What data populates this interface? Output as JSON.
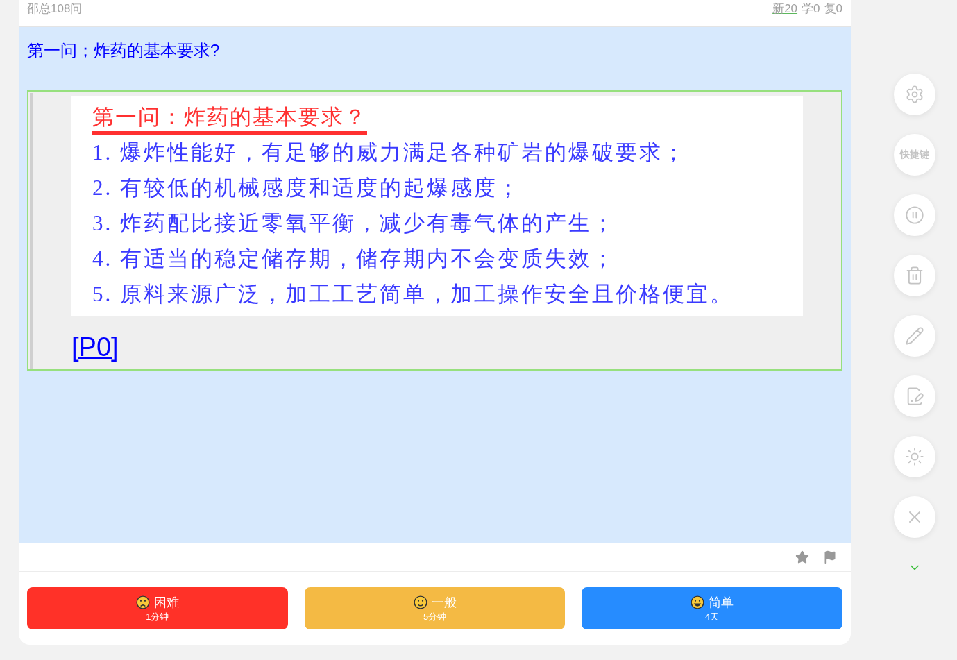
{
  "header": {
    "deck": "邵总108问",
    "counts": [
      {
        "label": "新20",
        "kind": "link"
      },
      {
        "label": "学0",
        "kind": "plain"
      },
      {
        "label": "复0",
        "kind": "plain"
      }
    ]
  },
  "question": "第一问；炸药的基本要求?",
  "answer": {
    "document": {
      "title": "第一问：炸药的基本要求？",
      "lines": [
        "1. 爆炸性能好，有足够的威力满足各种矿岩的爆破要求；",
        "2. 有较低的机械感度和适度的起爆感度；",
        "3. 炸药配比接近零氧平衡，减少有毒气体的产生；",
        "4. 有适当的稳定储存期，储存期内不会变质失效；",
        "5. 原料来源广泛，加工工艺简单，加工操作安全且价格便宜。"
      ]
    },
    "link": "[P0]"
  },
  "card_actions": [
    {
      "kind": "star"
    },
    {
      "kind": "flag"
    }
  ],
  "ratings": [
    {
      "label": "困难",
      "interval": "1分钟",
      "kind": "sad",
      "color": "#ff3128"
    },
    {
      "label": "一般",
      "interval": "5分钟",
      "kind": "neutral",
      "color": "#f4ba44"
    },
    {
      "label": "简单",
      "interval": "4天",
      "kind": "happy",
      "color": "#268cff"
    }
  ],
  "side_buttons": [
    {
      "kind": "settings"
    },
    {
      "kind": "text",
      "label": "快捷键"
    },
    {
      "kind": "pause"
    },
    {
      "kind": "trash"
    },
    {
      "kind": "pencil"
    },
    {
      "kind": "edit-note"
    },
    {
      "kind": "sun"
    },
    {
      "kind": "close"
    }
  ]
}
